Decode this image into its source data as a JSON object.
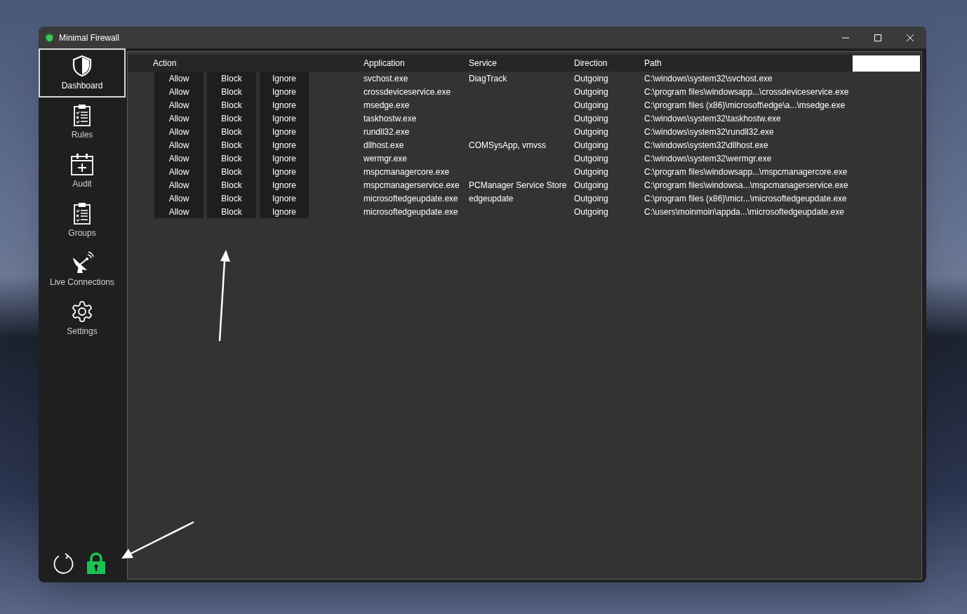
{
  "window": {
    "title": "Minimal Firewall"
  },
  "sidebar": {
    "items": [
      {
        "kind": "shield",
        "label": "Dashboard",
        "selected": true
      },
      {
        "kind": "clipboard",
        "label": "Rules",
        "selected": false
      },
      {
        "kind": "calendar",
        "label": "Audit",
        "selected": false
      },
      {
        "kind": "clipboard",
        "label": "Groups",
        "selected": false
      },
      {
        "kind": "dish",
        "label": "Live Connections",
        "selected": false
      },
      {
        "kind": "gear",
        "label": "Settings",
        "selected": false
      }
    ],
    "footer": {
      "locked": true
    }
  },
  "table": {
    "columns": [
      "Action",
      "Application",
      "Service",
      "Direction",
      "Path"
    ],
    "rows": [
      {
        "actions": [
          "Allow",
          "Block",
          "Ignore"
        ],
        "application": "svchost.exe",
        "service": "DiagTrack",
        "direction": "Outgoing",
        "path": "C:\\windows\\system32\\svchost.exe"
      },
      {
        "actions": [
          "Allow",
          "Block",
          "Ignore"
        ],
        "application": "crossdeviceservice.exe",
        "direction": "Outgoing",
        "path": "C:\\program files\\windowsapp...\\crossdeviceservice.exe"
      },
      {
        "actions": [
          "Allow",
          "Block",
          "Ignore"
        ],
        "application": "msedge.exe",
        "direction": "Outgoing",
        "path": "C:\\program files (x86)\\microsoft\\edge\\a...\\msedge.exe"
      },
      {
        "actions": [
          "Allow",
          "Block",
          "Ignore"
        ],
        "application": "taskhostw.exe",
        "direction": "Outgoing",
        "path": "C:\\windows\\system32\\taskhostw.exe"
      },
      {
        "actions": [
          "Allow",
          "Block",
          "Ignore"
        ],
        "application": "rundll32.exe",
        "direction": "Outgoing",
        "path": "C:\\windows\\system32\\rundll32.exe"
      },
      {
        "actions": [
          "Allow",
          "Block",
          "Ignore"
        ],
        "application": "dllhost.exe",
        "service": "COMSysApp, vmvss",
        "direction": "Outgoing",
        "path": "C:\\windows\\system32\\dllhost.exe"
      },
      {
        "actions": [
          "Allow",
          "Block",
          "Ignore"
        ],
        "application": "wermgr.exe",
        "direction": "Outgoing",
        "path": "C:\\windows\\system32\\wermgr.exe"
      },
      {
        "actions": [
          "Allow",
          "Block",
          "Ignore"
        ],
        "application": "mspcmanagercore.exe",
        "direction": "Outgoing",
        "path": "C:\\program files\\windowsapp...\\mspcmanagercore.exe"
      },
      {
        "actions": [
          "Allow",
          "Block",
          "Ignore"
        ],
        "application": "mspcmanagerservice.exe",
        "service": "PCManager Service Store",
        "direction": "Outgoing",
        "path": "C:\\program files\\windowsa...\\mspcmanagerservice.exe"
      },
      {
        "actions": [
          "Allow",
          "Block",
          "Ignore"
        ],
        "application": "microsoftedgeupdate.exe",
        "service": "edgeupdate",
        "direction": "Outgoing",
        "path": "C:\\program files (x86)\\micr...\\microsoftedgeupdate.exe"
      },
      {
        "actions": [
          "Allow",
          "Block",
          "Ignore"
        ],
        "application": "microsoftedgeupdate.exe",
        "direction": "Outgoing",
        "path": "C:\\users\\moinmoin\\appda...\\microsoftedgeupdate.exe"
      }
    ]
  }
}
